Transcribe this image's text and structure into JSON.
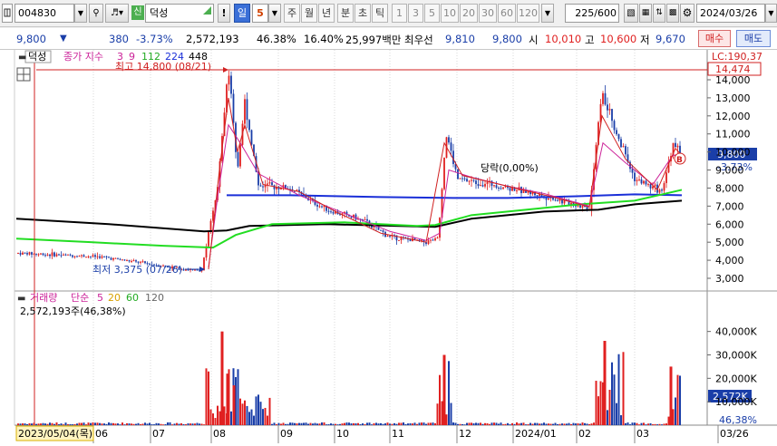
{
  "toolbar": {
    "code": "004830",
    "credit_badge": "신",
    "stock_name": "덕성",
    "alert": "!",
    "period_selected": "일",
    "period_count": "5",
    "periods": [
      "주",
      "월",
      "년",
      "분",
      "초",
      "틱"
    ],
    "intervals": [
      "1",
      "3",
      "5",
      "10",
      "20",
      "30",
      "60",
      "120"
    ],
    "range_value": "225",
    "range_total": "/600",
    "date": "2024/03/26"
  },
  "quote": {
    "price": "9,800",
    "arrow": "▼",
    "change": "380",
    "change_pct": "-3.73%",
    "volume": "2,572,193",
    "vol_ratio": "46.38%",
    "turnover": "16.40%",
    "amount": "25,997백만",
    "best_label": "최우선",
    "ask": "9,810",
    "bid": "9,800",
    "open_label": "시",
    "open": "10,010",
    "high_label": "고",
    "high": "10,600",
    "low_label": "저",
    "low": "9,670",
    "buy_label": "매수",
    "sell_label": "매도"
  },
  "price_panel": {
    "name_tag": "덕성",
    "legend_title": "종가 지수",
    "ma_periods": [
      "3",
      "9",
      "112",
      "224",
      "448"
    ],
    "lc_label": "LC:190,37",
    "high_flag": "14,474",
    "current_tag": "9,800",
    "current_pct": "-3.73%",
    "max_note": "최고 14,800 (08/21)",
    "min_note": "최저 3,375 (07/26)",
    "drop_note": "당락(0,00%)",
    "marker": "B",
    "y_ticks": [
      "14,000",
      "13,000",
      "12,000",
      "11,000",
      "10,000",
      "9,000",
      "8,000",
      "7,000",
      "6,000",
      "5,000",
      "4,000",
      "3,000"
    ]
  },
  "volume_panel": {
    "title": "거래량",
    "method": "단순",
    "ma_periods": [
      "5",
      "20",
      "60",
      "120"
    ],
    "value_line": "2,572,193주(46,38%)",
    "current_tag": "2,572K",
    "current_pct": "46,38%",
    "y_ticks": [
      "40,000K",
      "30,000K",
      "20,000K",
      "10,000K"
    ]
  },
  "x_axis": {
    "cursor_date": "2023/05/04(목)",
    "labels": [
      "06",
      "07",
      "08",
      "09",
      "10",
      "11",
      "12",
      "2024/01",
      "02",
      "03",
      "03/26"
    ]
  },
  "colors": {
    "up": "#e02020",
    "down": "#1a3ea8",
    "ma_green": "#22dd22",
    "ma_blue": "#1a2fd8",
    "ma_black": "#000000",
    "accent": "#3a6fd8"
  },
  "chart_data": {
    "type": "line",
    "x_labels": [
      "06",
      "07",
      "08",
      "09",
      "10",
      "11",
      "12",
      "2024/01",
      "02",
      "03"
    ],
    "close_path": [
      {
        "d": "07/26",
        "v": 3375
      },
      {
        "d": "08/21",
        "v": 14800
      },
      {
        "d": "09",
        "v": 8000
      },
      {
        "d": "10",
        "v": 6600
      },
      {
        "d": "11",
        "v": 5000
      },
      {
        "d": "12",
        "v": 8800
      },
      {
        "d": "2024/01",
        "v": 7400
      },
      {
        "d": "02",
        "v": 6900
      },
      {
        "d": "02 late",
        "v": 12000
      },
      {
        "d": "03",
        "v": 8000
      },
      {
        "d": "03/26",
        "v": 9800
      }
    ],
    "ylim": [
      3000,
      14500
    ]
  }
}
